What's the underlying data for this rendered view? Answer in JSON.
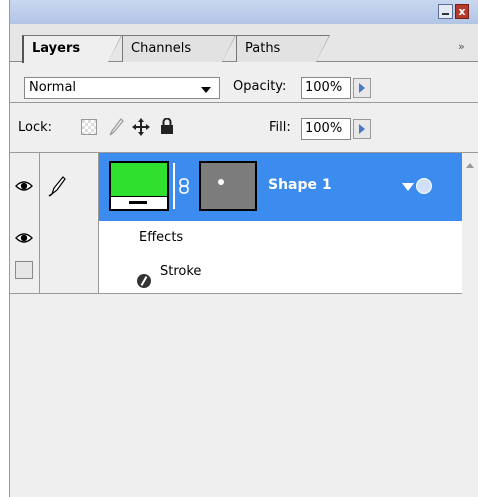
{
  "panel": {
    "tabs": [
      {
        "label": "Layers",
        "active": true
      },
      {
        "label": "Channels",
        "active": false
      },
      {
        "label": "Paths",
        "active": false
      }
    ],
    "more_label": "»",
    "close_label": "x"
  },
  "blend": {
    "mode": "Normal",
    "opacity_label": "Opacity:",
    "opacity_value": "100%"
  },
  "lock": {
    "label": "Lock:",
    "fill_label": "Fill:",
    "fill_value": "100%"
  },
  "layers": [
    {
      "name": "Shape 1",
      "thumbnail_color": "#2fe02f",
      "selected": true,
      "effects_label": "Effects",
      "effects": [
        "Stroke"
      ]
    }
  ],
  "colors": {
    "selection": "#3c8cf0",
    "panel_bg": "#efefef"
  }
}
